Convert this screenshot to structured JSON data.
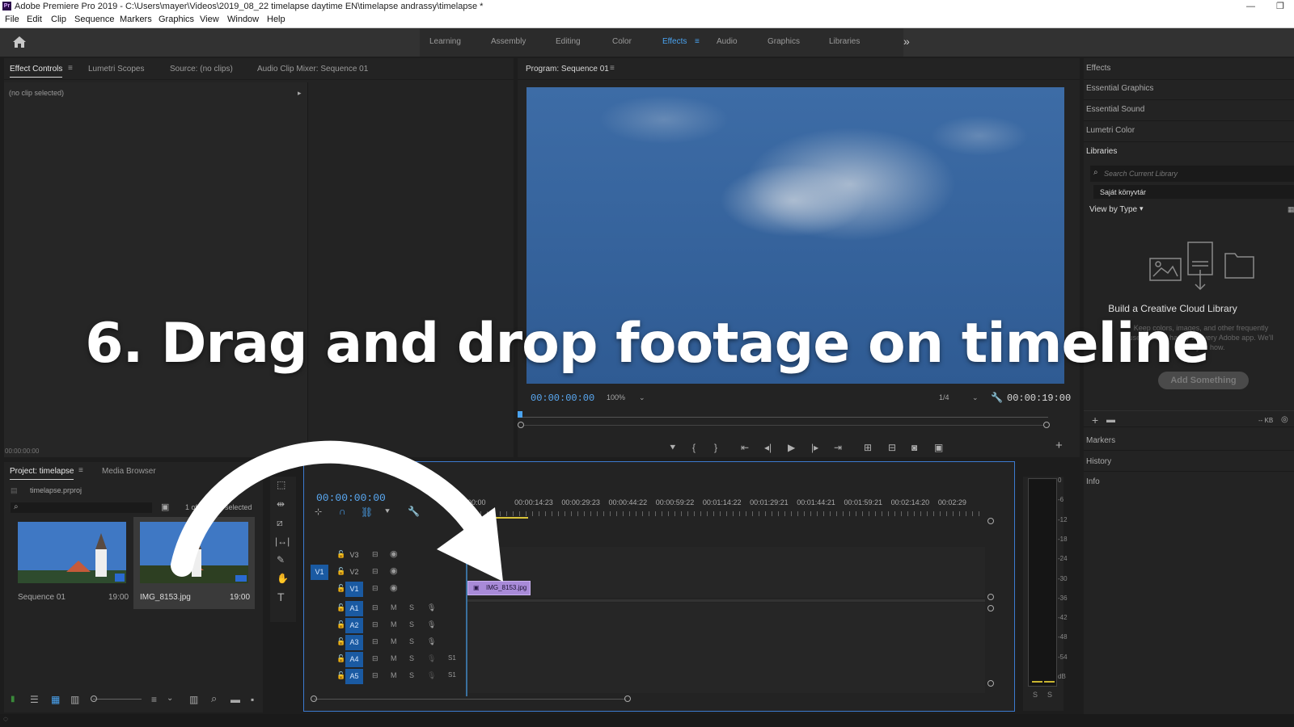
{
  "window": {
    "title": "Adobe Premiere Pro 2019 - C:\\Users\\mayer\\Videos\\2019_08_22 timelapse daytime EN\\timelapse andrassy\\timelapse *",
    "app_icon_text": "Pr"
  },
  "menu": [
    "File",
    "Edit",
    "Clip",
    "Sequence",
    "Markers",
    "Graphics",
    "View",
    "Window",
    "Help"
  ],
  "workspaces": {
    "tabs": [
      "Learning",
      "Assembly",
      "Editing",
      "Color",
      "Effects",
      "Audio",
      "Graphics",
      "Libraries"
    ],
    "active": "Effects"
  },
  "left_panel": {
    "tabs": [
      "Effect Controls",
      "Lumetri Scopes",
      "Source: (no clips)",
      "Audio Clip Mixer: Sequence 01"
    ],
    "no_clip": "(no clip selected)",
    "timecode": "00:00:00:00"
  },
  "program": {
    "tab": "Program: Sequence 01",
    "timecode_current": "00:00:00:00",
    "zoom": "100%",
    "resolution": "1/4",
    "timecode_duration": "00:00:19:00"
  },
  "right_panel": {
    "items": [
      "Effects",
      "Essential Graphics",
      "Essential Sound",
      "Lumetri Color",
      "Libraries"
    ],
    "search_placeholder": "Search Current Library",
    "library_name": "Saját könyvtár",
    "view_by": "View by Type",
    "cc_title": "Build a Creative Cloud Library",
    "cc_desc": "Keep colors, images, and other frequently used assets handy in every Adobe app. We'll show you how.",
    "add_button": "Add Something",
    "size_label": "-- KB",
    "bottom_items": [
      "Markers",
      "History",
      "Info"
    ]
  },
  "project": {
    "tabs": [
      "Project: timelapse",
      "Media Browser"
    ],
    "file": "timelapse.prproj",
    "selected_count": "1 of 2 items selected",
    "items": [
      {
        "name": "Sequence 01",
        "duration": "19:00"
      },
      {
        "name": "IMG_8153.jpg",
        "duration": "19:00"
      }
    ]
  },
  "timeline": {
    "timecode": "00:00:00:00",
    "ruler": [
      "00:00",
      "00:00:14:23",
      "00:00:29:23",
      "00:00:44:22",
      "00:00:59:22",
      "00:01:14:22",
      "00:01:29:21",
      "00:01:44:21",
      "00:01:59:21",
      "00:02:14:20",
      "00:02:29"
    ],
    "video_tracks": [
      "V3",
      "V2",
      "V1"
    ],
    "source_patch": "V1",
    "audio_tracks": [
      "A1",
      "A2",
      "A3",
      "A4",
      "A5"
    ],
    "audio_labels": {
      "m": "M",
      "s": "S",
      "level": "S1"
    },
    "clip_name": "IMG_8153.jpg"
  },
  "meter": {
    "scale": [
      "0",
      "-6",
      "-12",
      "-18",
      "-24",
      "-30",
      "-36",
      "-42",
      "-48",
      "-54",
      "dB"
    ],
    "solo": [
      "S",
      "S"
    ]
  },
  "overlay_caption": "6. Drag and drop footage on timeline",
  "colors": {
    "accent_blue": "#4aa3f0",
    "clip_purple": "#a88ad8",
    "sky": "#3a6aa6"
  }
}
